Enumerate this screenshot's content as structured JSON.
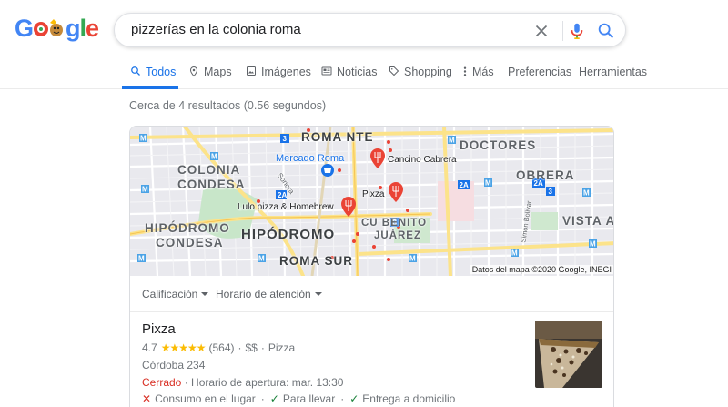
{
  "logo": {
    "letters": [
      "G",
      "o",
      "o",
      "g",
      "l",
      "e"
    ]
  },
  "search": {
    "query": "pizzerías en la colonia roma"
  },
  "tabs": [
    {
      "label": "Todos",
      "icon": "search-icon",
      "active": true
    },
    {
      "label": "Maps",
      "icon": "map-pin-icon"
    },
    {
      "label": "Imágenes",
      "icon": "image-icon"
    },
    {
      "label": "Noticias",
      "icon": "news-icon"
    },
    {
      "label": "Shopping",
      "icon": "tag-icon"
    },
    {
      "label": "Más",
      "icon": "more-vert-icon"
    },
    {
      "label": "Preferencias"
    },
    {
      "label": "Herramientas"
    }
  ],
  "result_stats": "Cerca de 4 resultados (0.56 segundos)",
  "map": {
    "neighborhoods": {
      "roma_nte": "ROMA NTE",
      "doctores": "DOCTORES",
      "colonia": "COLONIA",
      "condesa": "CONDESA",
      "obrera": "OBRERA",
      "vista_aleg": "VISTA ALEG",
      "hipodromo": "HIPÓDROMO",
      "condesa2": "CONDESA",
      "hipodromo2": "HIPÓDROMO",
      "cu_benito": "CU BENITO",
      "juarez": "JUÁREZ",
      "roma_sur": "ROMA SUR"
    },
    "pois": {
      "mercado": "Mercado Roma",
      "cancino": "Cancino Cabrera",
      "pixza": "Pixza",
      "lulo": "Lulo pizza & Homebrew"
    },
    "streets": {
      "sonora": "Sonora",
      "simon": "Simon Bolivar"
    },
    "route_numbers": [
      "3",
      "2A",
      "3",
      "2A",
      "2A",
      "3"
    ],
    "attribution": "Datos del mapa ©2020 Google, INEGI"
  },
  "filters": {
    "rating": "Calificación",
    "hours": "Horario de atención"
  },
  "listing": {
    "name": "Pixza",
    "rating": "4.7",
    "stars": "★★★★★",
    "reviews": "(564)",
    "price": "$$",
    "category": "Pizza",
    "address": "Córdoba 234",
    "status": "Cerrado",
    "hours": "Horario de apertura: mar. 13:30",
    "services": [
      {
        "label": "Consumo en el lugar",
        "available": false
      },
      {
        "label": "Para llevar",
        "available": true
      },
      {
        "label": "Entrega a domicilio",
        "available": true
      }
    ]
  },
  "colors": {
    "accent": "#1a73e8",
    "closed": "#d93025",
    "star": "#fbbc04",
    "pin": "#ea4335"
  }
}
